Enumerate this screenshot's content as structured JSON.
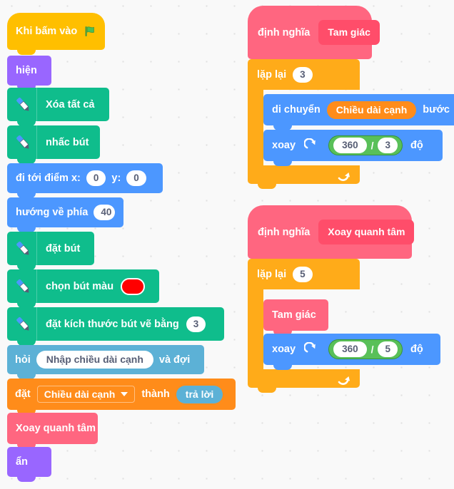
{
  "app": {
    "name": "scratch-block-editor",
    "language": "vi",
    "canvas_background": "#f9f9f9",
    "grid_dot_color": "#e0e0e0"
  },
  "palette": {
    "events": "#ffbf00",
    "looks": "#9966ff",
    "pen": "#0fbd8c",
    "motion": "#4c97ff",
    "sensing": "#5cb1d6",
    "variables": "#ff8c1a",
    "control": "#ffab19",
    "custom": "#ff6680",
    "custom_dark": "#ff4d6a",
    "operators": "#59c059",
    "operators_border": "#389438",
    "pen_color_swatch": "#ff0000"
  },
  "scripts": {
    "main": {
      "name": "main-script",
      "blocks": [
        {
          "id": "when-flag",
          "category": "events",
          "label": "Khi bấm vào",
          "icon": "green-flag-icon"
        },
        {
          "id": "show",
          "category": "looks",
          "label": "hiện"
        },
        {
          "id": "erase-all",
          "category": "pen",
          "label": "Xóa tất cả",
          "icon": "pen-icon"
        },
        {
          "id": "pen-up",
          "category": "pen",
          "label": "nhấc bút",
          "icon": "pen-icon"
        },
        {
          "id": "goto-xy",
          "category": "motion",
          "label_x": "đi tới điểm x:",
          "x": "0",
          "label_y": "y:",
          "y": "0"
        },
        {
          "id": "point-dir",
          "category": "motion",
          "label": "hướng về phía",
          "value": "40"
        },
        {
          "id": "pen-down",
          "category": "pen",
          "label": "đặt bút",
          "icon": "pen-icon"
        },
        {
          "id": "set-pen-color",
          "category": "pen",
          "label": "chọn bút màu",
          "icon": "pen-icon",
          "color": "#ff0000"
        },
        {
          "id": "set-pen-size",
          "category": "pen",
          "label": "đặt kích thước bút vẽ bằng",
          "icon": "pen-icon",
          "value": "3"
        },
        {
          "id": "ask-wait",
          "category": "sensing",
          "label_pre": "hỏi",
          "prompt": "Nhập chiều dài cạnh",
          "label_post": "và đợi"
        },
        {
          "id": "set-var",
          "category": "variables",
          "label_pre": "đặt",
          "variable": "Chiều dài cạnh",
          "label_mid": "thành",
          "reporter": "trả lời"
        },
        {
          "id": "call-rotate",
          "category": "custom",
          "label": "Xoay quanh tâm"
        },
        {
          "id": "hide",
          "category": "looks",
          "label": "ẩn"
        }
      ]
    },
    "define_triangle": {
      "name": "define-tam-giac",
      "hat": {
        "label": "định nghĩa",
        "procedure": "Tam giác"
      },
      "repeat": {
        "label": "lặp lại",
        "times": "3",
        "icon": "loop-arrow-icon"
      },
      "body": [
        {
          "id": "move-steps",
          "category": "motion",
          "label_pre": "di chuyển",
          "reporter": "Chiều dài cạnh",
          "label_post": "bước"
        },
        {
          "id": "turn-right",
          "category": "motion",
          "label_pre": "xoay",
          "icon": "turn-clockwise-icon",
          "operator": {
            "type": "divide",
            "left": "360",
            "right": "3",
            "symbol": "/"
          },
          "label_post": "độ"
        }
      ]
    },
    "define_rotate": {
      "name": "define-xoay-quanh-tam",
      "hat": {
        "label": "định nghĩa",
        "procedure": "Xoay quanh tâm"
      },
      "repeat": {
        "label": "lặp lại",
        "times": "5",
        "icon": "loop-arrow-icon"
      },
      "body": [
        {
          "id": "call-triangle",
          "category": "custom",
          "label": "Tam giác"
        },
        {
          "id": "turn-right",
          "category": "motion",
          "label_pre": "xoay",
          "icon": "turn-clockwise-icon",
          "operator": {
            "type": "divide",
            "left": "360",
            "right": "5",
            "symbol": "/"
          },
          "label_post": "độ"
        }
      ]
    }
  }
}
